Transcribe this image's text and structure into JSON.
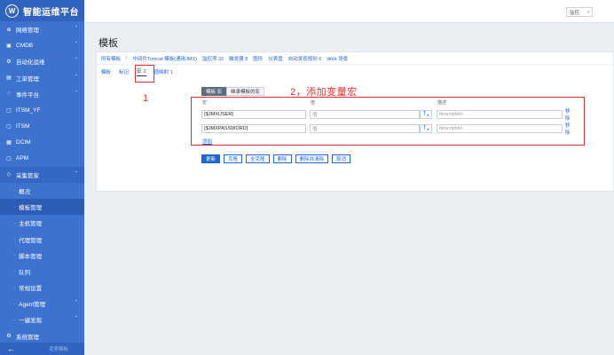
{
  "app": {
    "title": "智能运维平台",
    "logo_letter": "W"
  },
  "sidebar": {
    "items": [
      {
        "label": "网络管理",
        "icon": "globe-icon",
        "has_chevron": true
      },
      {
        "label": "CMDB",
        "icon": "database-icon",
        "has_chevron": true
      },
      {
        "label": "自动化运维",
        "icon": "automation-icon",
        "has_chevron": true
      },
      {
        "label": "工单管理",
        "icon": "ticket-icon",
        "has_chevron": true
      },
      {
        "label": "事件平台",
        "icon": "bell-icon",
        "has_chevron": true
      },
      {
        "label": "ITSM_YF",
        "icon": "doc-icon",
        "has_chevron": false
      },
      {
        "label": "ITSM",
        "icon": "doc-icon",
        "has_chevron": false
      },
      {
        "label": "DCIM",
        "icon": "server-icon",
        "has_chevron": false
      },
      {
        "label": "APM",
        "icon": "doc-icon",
        "has_chevron": false
      },
      {
        "label": "采集管家",
        "icon": "collect-icon",
        "has_chevron": true,
        "expanded": true
      }
    ],
    "subitems": [
      {
        "label": "概况"
      },
      {
        "label": "模板管理",
        "active": true
      },
      {
        "label": "主机管理"
      },
      {
        "label": "代理管理"
      },
      {
        "label": "脚本管理"
      },
      {
        "label": "队列"
      },
      {
        "label": "常规设置"
      },
      {
        "label": "Agent管理",
        "has_chevron": true
      },
      {
        "label": "一键发现",
        "has_chevron": true
      }
    ],
    "last_item": {
      "label": "系统管理",
      "icon": "gear-icon"
    },
    "bottom_arrow": "←",
    "bottom_hint": "变更模板"
  },
  "topbar": {
    "select_value": "监控"
  },
  "page": {
    "title": "模板"
  },
  "breadcrumb": {
    "items": [
      "所有模板",
      "中间件Tomcat 模板(通用JMX)",
      "监控项 32",
      "触发器 8",
      "图形",
      "仪表盘",
      "自动发现规则 6",
      "Web 场景"
    ],
    "separator": "/"
  },
  "tabs": [
    {
      "label": "模板",
      "current": false
    },
    {
      "label": "标记",
      "current": false
    },
    {
      "label": "宏",
      "count": "2",
      "current": true
    },
    {
      "label": "值映射",
      "count": "1",
      "current": false
    }
  ],
  "annotations": {
    "step1": "1",
    "step2": "2，添加变量宏"
  },
  "macro_subtabs": [
    {
      "label": "模板 宏",
      "current": true
    },
    {
      "label": "继承模板的宏",
      "current": false
    }
  ],
  "columns": {
    "macro": "宏",
    "value": "值",
    "desc": "描述"
  },
  "macros": [
    {
      "macro": "{$JMXUSER}",
      "value_placeholder": "值",
      "type_symbol": "T",
      "desc_placeholder": "description",
      "remove_label": "移除"
    },
    {
      "macro": "{$JMXPASSWORD}",
      "value_placeholder": "值",
      "type_symbol": "T",
      "desc_placeholder": "description",
      "remove_label": "移除"
    }
  ],
  "add_label": "添加",
  "buttons": {
    "update": "更新",
    "clone": "克隆",
    "full_clone": "全克隆",
    "delete": "删除",
    "delete_clear": "删除并清除",
    "cancel": "取消"
  },
  "colors": {
    "sidebar": "#3d73cf",
    "accent": "#1f65d6",
    "annotation": "#e12c2c"
  }
}
